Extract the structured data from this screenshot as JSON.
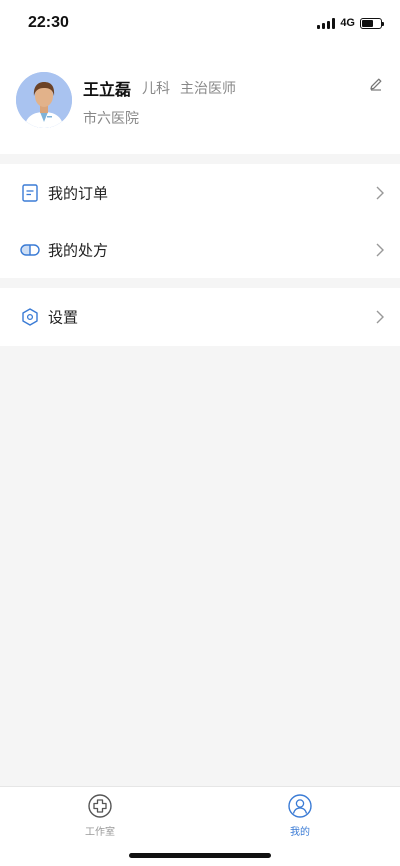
{
  "status_bar": {
    "time": "22:30",
    "network": "4G",
    "battery_level": 0.6
  },
  "profile": {
    "name": "王立磊",
    "department": "儿科",
    "title": "主治医师",
    "hospital": "市六医院",
    "avatar_icon": "doctor-avatar-icon",
    "edit_icon": "pencil-icon"
  },
  "menu": {
    "orders": {
      "label": "我的订单",
      "icon": "document-icon"
    },
    "prescriptions": {
      "label": "我的处方",
      "icon": "pill-icon"
    },
    "settings": {
      "label": "设置",
      "icon": "hexagon-gear-icon"
    }
  },
  "tab_bar": {
    "tabs": [
      {
        "label": "工作室",
        "icon": "medical-cross-icon",
        "active": false
      },
      {
        "label": "我的",
        "icon": "user-icon",
        "active": true
      }
    ]
  },
  "colors": {
    "accent": "#3a7bd5",
    "background": "#f5f5f5",
    "text_secondary": "#888888"
  }
}
